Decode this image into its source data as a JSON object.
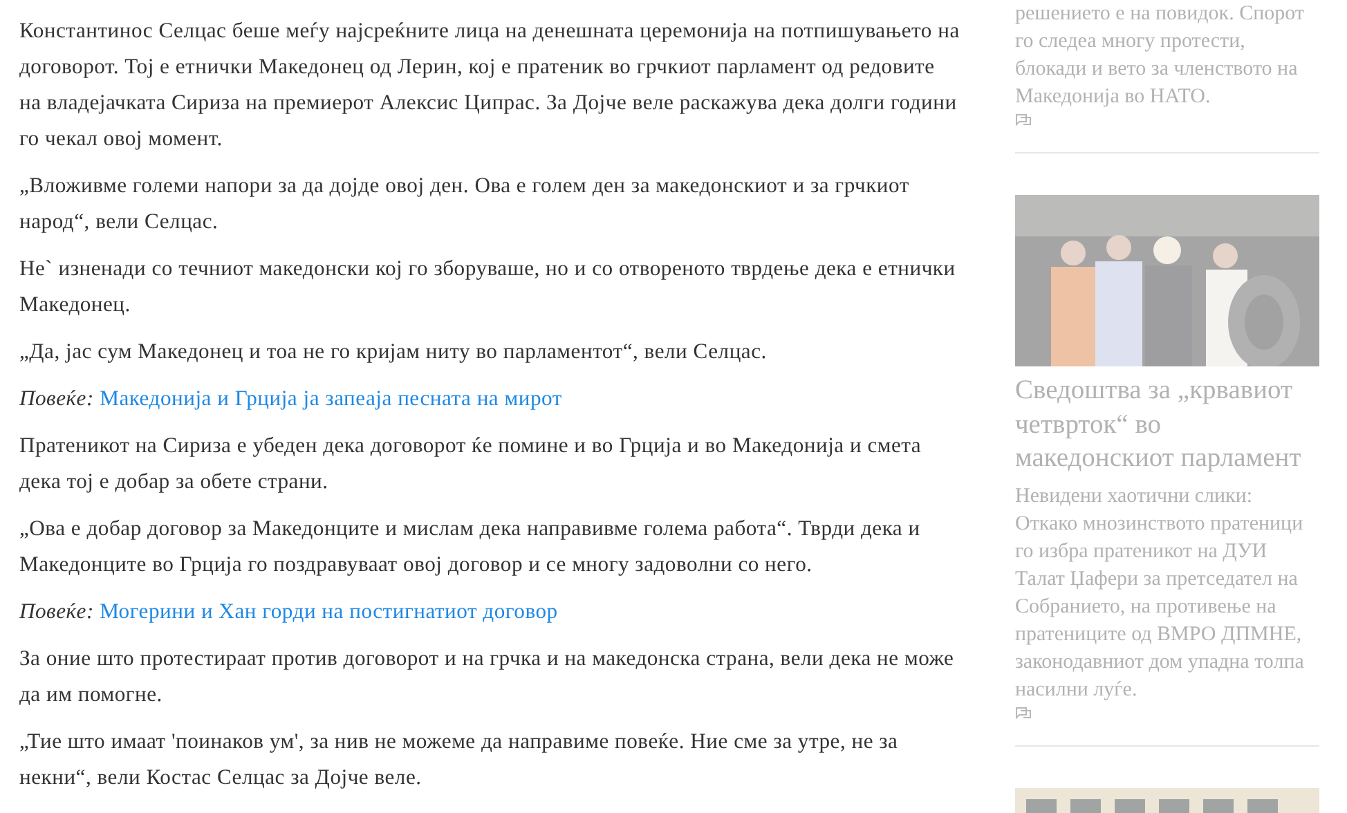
{
  "article": [
    {
      "kind": "text",
      "text": "Константинос Селцас беше меѓу најсреќните лица на денешната церемонија на потпишувањето на договорот. Тој е етнички Македонец од Лерин, кој е пратеник во грчкиот парламент од редовите на владејачката Сириза на премиерот Алексис Ципрас. За Дојче веле раскажува дека долги години го чекал овој момент."
    },
    {
      "kind": "text",
      "text": "„Вложивме големи напори за да дојде овој ден. Ова е голем ден за македонскиот и за грчкиот народ“, вели Селцас."
    },
    {
      "kind": "text",
      "text": "Не` изненади со течниот македонски кој го зборуваше, но и со отвореното тврдење дека е етнички Македонец."
    },
    {
      "kind": "text",
      "text": "„Да, јас сум Македонец и тоа не го кријам ниту во парламентот“, вели Селцас."
    },
    {
      "kind": "more",
      "label": "Повеќе:",
      "link": "Македонија и Грција ја запеаја песната на мирот"
    },
    {
      "kind": "text",
      "text": "Пратеникот на Сириза е убеден дека договорот ќе помине и во Грција и во Македонија и смета дека тој е добар за обете страни."
    },
    {
      "kind": "text",
      "text": "„Ова е добар договор за Македонците и мислам дека направивме голема работа“. Тврди дека и Македонците во Грција го поздравуваат овој договор и се многу задоволни со него."
    },
    {
      "kind": "more",
      "label": "Повеќе:",
      "link": "Могерини и Хан горди на постигнатиот договор"
    },
    {
      "kind": "text",
      "text": "За оние што протестираат против договорот и на грчка и на македонска страна, вели дека не може да им помогне."
    },
    {
      "kind": "text",
      "text": "„Тие што имаат 'поинаков ум', за нив не можеме да направиме повеќе. Ние сме за утре, не за некни“, вели Костас Селцас за Дојче веле."
    }
  ],
  "sidebar": [
    {
      "summary": "решението е на повидок. Спорот го следеа многу протести, блокади и вето за членството на Македонија во НАТО."
    },
    {
      "kind": "picture",
      "headline": "Сведоштва за „крвавиот четврток“ во македонскиот парламент",
      "summary": "Невидени хаотични слики: Откако мнозинството пратеници го избра пратеникот на ДУИ Талат Џафери за претседател на Собранието, на противење на пратениците од ВМРО ДПМНЕ, законодавниот дом упадна толпа насилни луѓе."
    },
    {
      "kind": "picture"
    }
  ]
}
